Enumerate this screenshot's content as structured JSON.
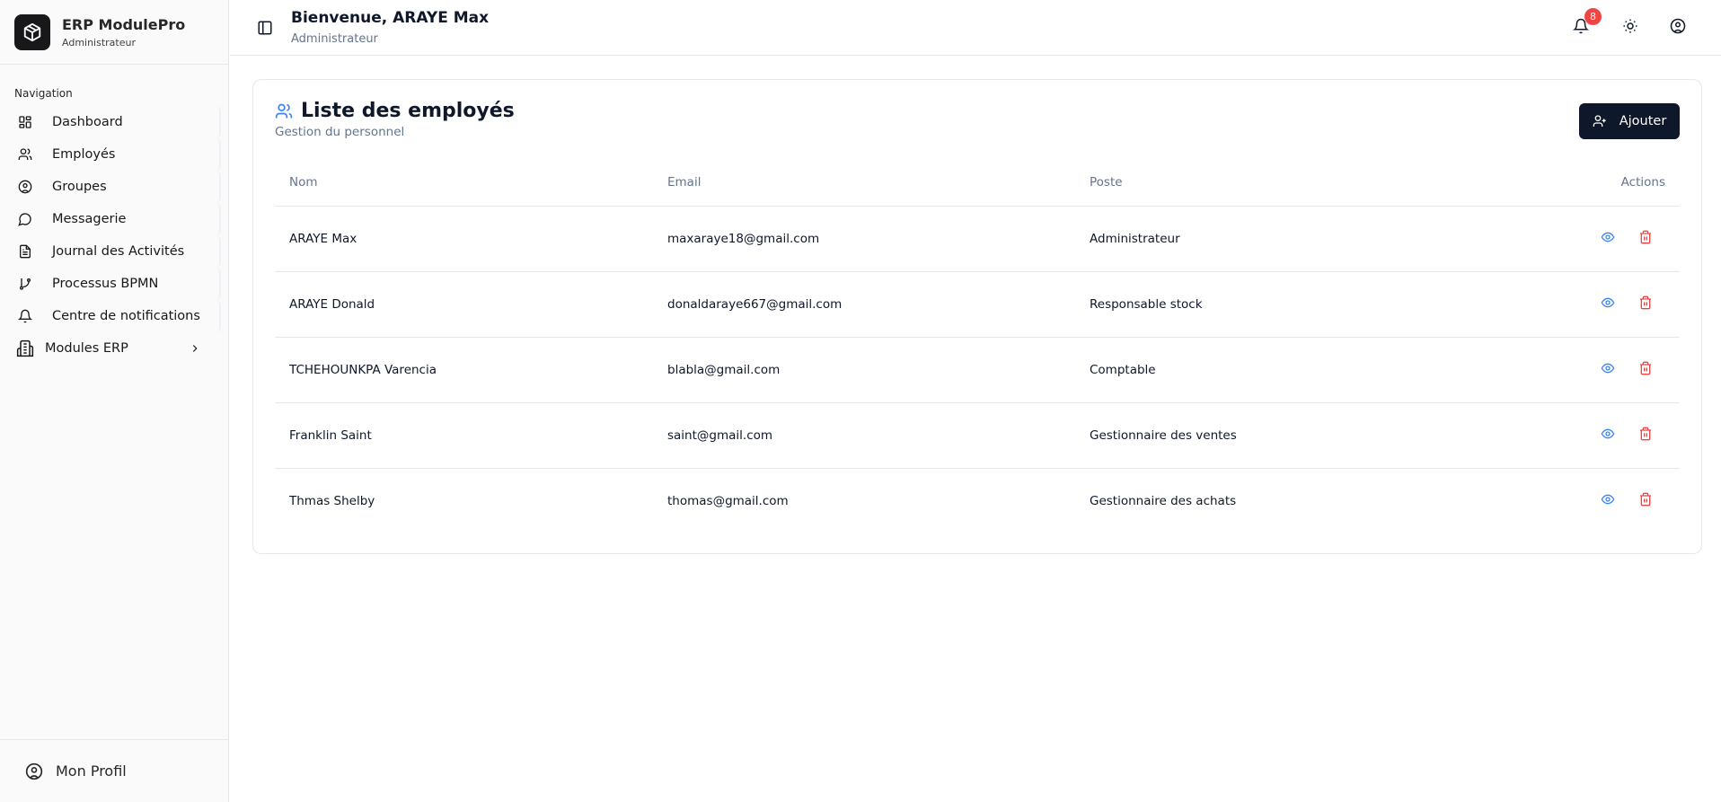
{
  "brand": {
    "title": "ERP ModulePro",
    "subtitle": "Administrateur"
  },
  "sidebar": {
    "nav_label": "Navigation",
    "items": [
      {
        "label": "Dashboard",
        "icon": "dashboard-icon"
      },
      {
        "label": "Employés",
        "icon": "users-icon"
      },
      {
        "label": "Groupes",
        "icon": "user-circle-icon"
      },
      {
        "label": "Messagerie",
        "icon": "message-icon"
      },
      {
        "label": "Journal des Activités",
        "icon": "file-text-icon"
      },
      {
        "label": "Processus BPMN",
        "icon": "git-branch-icon"
      },
      {
        "label": "Centre de notifications",
        "icon": "bell-icon"
      },
      {
        "label": "Modules ERP",
        "icon": "building-icon"
      }
    ],
    "profile": "Mon Profil"
  },
  "header": {
    "title": "Bienvenue, ARAYE Max",
    "subtitle": "Administrateur",
    "notification_count": "8"
  },
  "card": {
    "title": "Liste des employés",
    "subtitle": "Gestion du personnel",
    "add_label": "Ajouter",
    "columns": [
      "Nom",
      "Email",
      "Poste",
      "Actions"
    ],
    "rows": [
      {
        "name": "ARAYE Max",
        "email": "maxaraye18@gmail.com",
        "poste": "Administrateur"
      },
      {
        "name": "ARAYE Donald",
        "email": "donaldaraye667@gmail.com",
        "poste": "Responsable stock"
      },
      {
        "name": "TCHEHOUNKPA Varencia",
        "email": "blabla@gmail.com",
        "poste": "Comptable"
      },
      {
        "name": "Franklin Saint",
        "email": "saint@gmail.com",
        "poste": "Gestionnaire des ventes"
      },
      {
        "name": "Thmas Shelby",
        "email": "thomas@gmail.com",
        "poste": "Gestionnaire des achats"
      }
    ]
  },
  "colors": {
    "primary": "#0f172a",
    "accent": "#3b82f6",
    "danger": "#ef4444"
  }
}
